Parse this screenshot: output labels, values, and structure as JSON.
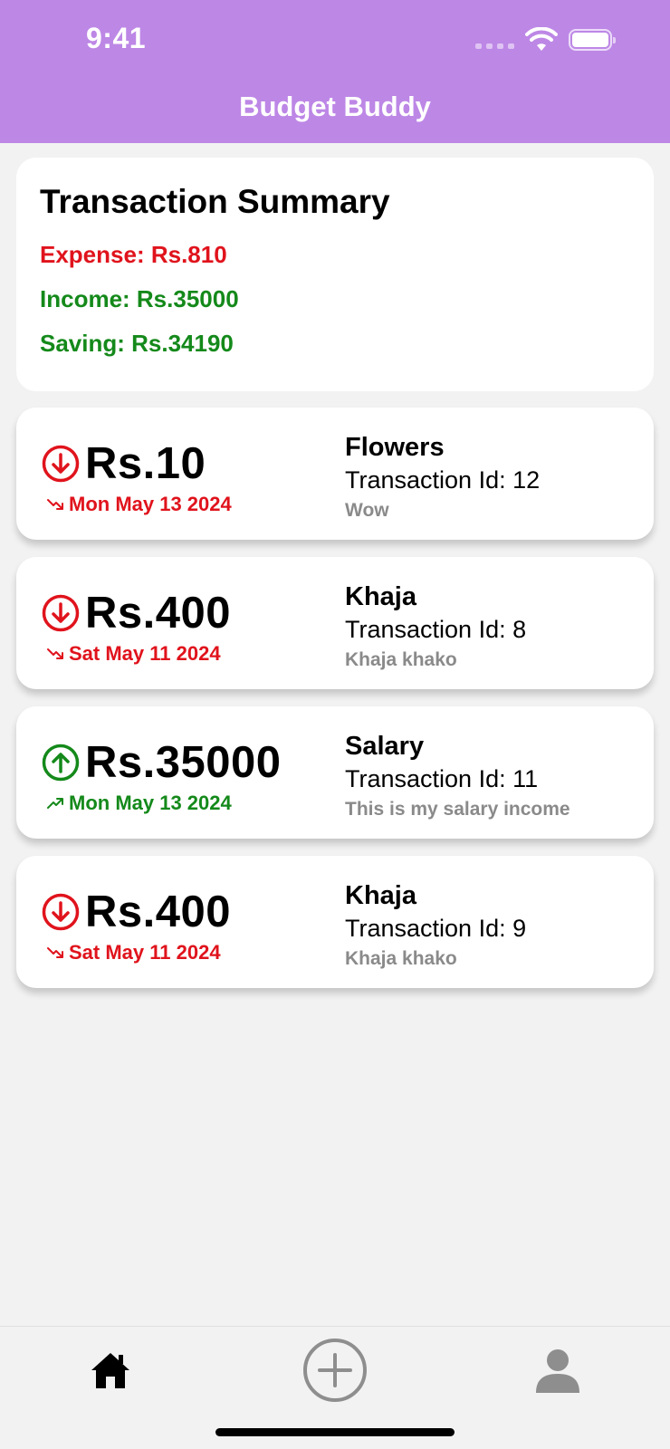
{
  "status_bar": {
    "time": "9:41"
  },
  "header": {
    "title": "Budget Buddy"
  },
  "summary": {
    "title": "Transaction Summary",
    "expense": "Expense: Rs.810",
    "income": "Income: Rs.35000",
    "saving": "Saving: Rs.34190"
  },
  "transactions": [
    {
      "type": "expense",
      "amount": "Rs.10",
      "date": "Mon May 13 2024",
      "name": "Flowers",
      "transaction_id": "Transaction Id: 12",
      "note": "Wow"
    },
    {
      "type": "expense",
      "amount": "Rs.400",
      "date": "Sat May 11 2024",
      "name": "Khaja",
      "transaction_id": "Transaction Id: 8",
      "note": "Khaja khako"
    },
    {
      "type": "income",
      "amount": "Rs.35000",
      "date": "Mon May 13 2024",
      "name": "Salary",
      "transaction_id": "Transaction Id: 11",
      "note": "This is my salary income"
    },
    {
      "type": "expense",
      "amount": "Rs.400",
      "date": "Sat May 11 2024",
      "name": "Khaja",
      "transaction_id": "Transaction Id: 9",
      "note": "Khaja khako"
    }
  ],
  "tab_bar": {
    "tabs": [
      {
        "icon": "home-icon",
        "active": true
      },
      {
        "icon": "add-circle-icon",
        "active": false
      },
      {
        "icon": "person-icon",
        "active": false
      }
    ]
  },
  "colors": {
    "header_bg": "#bd87e6",
    "expense": "#e0131c",
    "income": "#14891a",
    "background": "#f2f2f2"
  }
}
